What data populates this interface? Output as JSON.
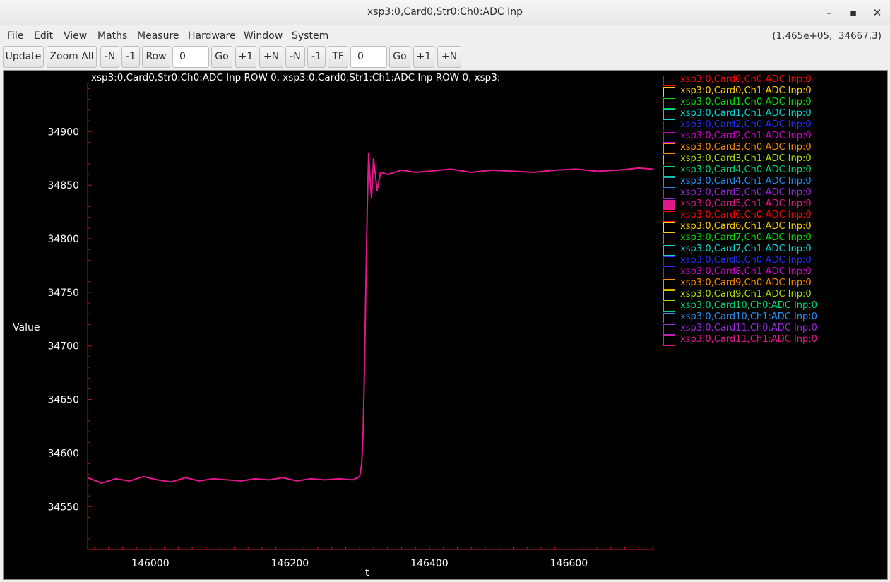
{
  "window": {
    "title": "xsp3:0,Card0,Str0:Ch0:ADC Inp",
    "controls": {
      "minimize": "–",
      "maximize": "▪",
      "close": "✕"
    }
  },
  "menubar": {
    "items": [
      "File",
      "Edit",
      "View",
      "Maths",
      "Measure",
      "Hardware",
      "Window",
      "System"
    ],
    "coords_readout": "(1.465e+05,  34667.3)"
  },
  "toolbar": {
    "update": "Update",
    "zoom_all": "Zoom All",
    "row_minus_n": "-N",
    "row_minus_1": "-1",
    "row": "Row",
    "row_value": "0",
    "row_go": "Go",
    "row_plus_1": "+1",
    "row_plus_n": "+N",
    "tf_minus_n": "-N",
    "tf_minus_1": "-1",
    "tf": "TF",
    "tf_value": "0",
    "tf_go": "Go",
    "tf_plus_1": "+1",
    "tf_plus_n": "+N"
  },
  "plot": {
    "title": "xsp3:0,Card0,Str0:Ch0:ADC Inp ROW 0, xsp3:0,Card0,Str1:Ch1:ADC Inp ROW 0, xsp3:",
    "ylabel": "Value",
    "xlabel": "t"
  },
  "legend": [
    {
      "label": "xsp3:0,Card0,Ch0:ADC Inp:0",
      "color": "#ff0000",
      "selected": false
    },
    {
      "label": "xsp3:0,Card0,Ch1:ADC Inp:0",
      "color": "#ffd000",
      "selected": false
    },
    {
      "label": "xsp3:0,Card1,Ch0:ADC Inp:0",
      "color": "#00e000",
      "selected": false
    },
    {
      "label": "xsp3:0,Card1,Ch1:ADC Inp:0",
      "color": "#00d8d8",
      "selected": false
    },
    {
      "label": "xsp3:0,Card2,Ch0:ADC Inp:0",
      "color": "#2030ff",
      "selected": false
    },
    {
      "label": "xsp3:0,Card2,Ch1:ADC Inp:0",
      "color": "#d000d0",
      "selected": false
    },
    {
      "label": "xsp3:0,Card3,Ch0:ADC Inp:0",
      "color": "#ff8c00",
      "selected": false
    },
    {
      "label": "xsp3:0,Card3,Ch1:ADC Inp:0",
      "color": "#b0e000",
      "selected": false
    },
    {
      "label": "xsp3:0,Card4,Ch0:ADC Inp:0",
      "color": "#00d878",
      "selected": false
    },
    {
      "label": "xsp3:0,Card4,Ch1:ADC Inp:0",
      "color": "#2890f0",
      "selected": false
    },
    {
      "label": "xsp3:0,Card5,Ch0:ADC Inp:0",
      "color": "#9a28e0",
      "selected": false
    },
    {
      "label": "xsp3:0,Card5,Ch1:ADC Inp:0",
      "color": "#e0188c",
      "selected": true
    },
    {
      "label": "xsp3:0,Card6,Ch0:ADC Inp:0",
      "color": "#ff0000",
      "selected": false
    },
    {
      "label": "xsp3:0,Card6,Ch1:ADC Inp:0",
      "color": "#ffd000",
      "selected": false
    },
    {
      "label": "xsp3:0,Card7,Ch0:ADC Inp:0",
      "color": "#00e000",
      "selected": false
    },
    {
      "label": "xsp3:0,Card7,Ch1:ADC Inp:0",
      "color": "#00d8d8",
      "selected": false
    },
    {
      "label": "xsp3:0,Card8,Ch0:ADC Inp:0",
      "color": "#2030ff",
      "selected": false
    },
    {
      "label": "xsp3:0,Card8,Ch1:ADC Inp:0",
      "color": "#d000d0",
      "selected": false
    },
    {
      "label": "xsp3:0,Card9,Ch0:ADC Inp:0",
      "color": "#ff8c00",
      "selected": false
    },
    {
      "label": "xsp3:0,Card9,Ch1:ADC Inp:0",
      "color": "#b0e000",
      "selected": false
    },
    {
      "label": "xsp3:0,Card10,Ch0:ADC Inp:0",
      "color": "#00d878",
      "selected": false
    },
    {
      "label": "xsp3:0,Card10,Ch1:ADC Inp:0",
      "color": "#2890f0",
      "selected": false
    },
    {
      "label": "xsp3:0,Card11,Ch0:ADC Inp:0",
      "color": "#9a28e0",
      "selected": false
    },
    {
      "label": "xsp3:0,Card11,Ch1:ADC Inp:0",
      "color": "#e0188c",
      "selected": false
    }
  ],
  "chart_data": {
    "type": "line",
    "title": "xsp3:0,Card0,Str0:Ch0:ADC Inp ROW 0, xsp3:0,Card0,Str1:Ch1:ADC Inp ROW 0, xsp3:",
    "xlabel": "t",
    "ylabel": "Value",
    "xlim": [
      145910,
      146720
    ],
    "ylim": [
      34510,
      34945
    ],
    "xticks": [
      146000,
      146200,
      146400,
      146600
    ],
    "yticks": [
      34550,
      34600,
      34650,
      34700,
      34750,
      34800,
      34850,
      34900
    ],
    "grid": false,
    "legend_position": "right",
    "series": [
      {
        "name": "xsp3:0,Card5,Ch1:ADC Inp:0",
        "color": "#e0188c",
        "x": [
          145910,
          145930,
          145950,
          145970,
          145990,
          146010,
          146030,
          146050,
          146070,
          146090,
          146110,
          146130,
          146150,
          146170,
          146190,
          146210,
          146230,
          146250,
          146270,
          146290,
          146300,
          146303,
          146305,
          146307,
          146309,
          146311,
          146313,
          146315,
          146317,
          146320,
          146325,
          146330,
          146340,
          146360,
          146380,
          146400,
          146430,
          146460,
          146490,
          146520,
          146550,
          146580,
          146610,
          146640,
          146670,
          146700,
          146720
        ],
        "y": [
          34577,
          34572,
          34576,
          34574,
          34578,
          34575,
          34573,
          34577,
          34574,
          34576,
          34575,
          34574,
          34576,
          34575,
          34577,
          34574,
          34576,
          34575,
          34576,
          34575,
          34578,
          34590,
          34620,
          34680,
          34760,
          34830,
          34880,
          34855,
          34838,
          34875,
          34845,
          34862,
          34860,
          34864,
          34862,
          34863,
          34865,
          34862,
          34864,
          34863,
          34862,
          34864,
          34865,
          34863,
          34864,
          34866,
          34865
        ]
      }
    ]
  }
}
